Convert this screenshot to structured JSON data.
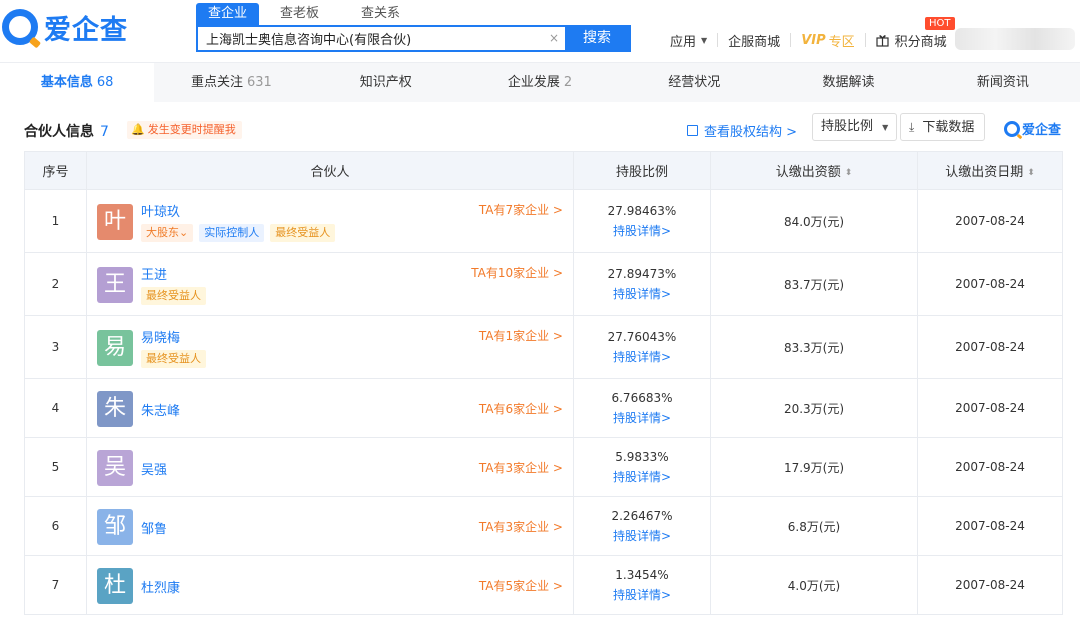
{
  "header": {
    "logo_text": "爱企查",
    "search_tabs": [
      "查企业",
      "查老板",
      "查关系"
    ],
    "search_value": "上海凯士奥信息咨询中心(有限合伙)",
    "clear_icon": "×",
    "search_button": "搜索",
    "nav": {
      "apps": "应用",
      "service_mall": "企服商城",
      "vip": "VIP",
      "vip_zone": "专区",
      "points_mall": "积分商城",
      "hot": "HOT"
    }
  },
  "section_tabs": [
    {
      "label": "基本信息",
      "count": "68"
    },
    {
      "label": "重点关注",
      "count": "631"
    },
    {
      "label": "知识产权",
      "count": ""
    },
    {
      "label": "企业发展",
      "count": "2"
    },
    {
      "label": "经营状况",
      "count": ""
    },
    {
      "label": "数据解读",
      "count": ""
    },
    {
      "label": "新闻资讯",
      "count": ""
    }
  ],
  "partners": {
    "title": "合伙人信息",
    "count": "7",
    "alert": "发生变更时提醒我",
    "equity_link": "查看股权结构 >",
    "ratio_button": "持股比例",
    "download_button": "下载数据",
    "brand": "爱企查",
    "columns": {
      "seq": "序号",
      "partner": "合伙人",
      "ratio": "持股比例",
      "capital": "认缴出资额",
      "date": "认缴出资日期"
    },
    "detail_label": "持股详情>",
    "rows": [
      {
        "seq": "1",
        "avatar": "叶",
        "avatar_color": "#e58a6d",
        "name": "叶琼玖",
        "tags": [
          {
            "text": "大股东⌄",
            "style": "orange"
          },
          {
            "text": "实际控制人",
            "style": "blue"
          },
          {
            "text": "最终受益人",
            "style": "yellow"
          }
        ],
        "companies": "TA有7家企业 >",
        "ratio": "27.98463%",
        "capital": "84.0万(元)",
        "date": "2007-08-24"
      },
      {
        "seq": "2",
        "avatar": "王",
        "avatar_color": "#b49fd3",
        "name": "王进",
        "tags": [
          {
            "text": "最终受益人",
            "style": "yellow"
          }
        ],
        "companies": "TA有10家企业 >",
        "ratio": "27.89473%",
        "capital": "83.7万(元)",
        "date": "2007-08-24"
      },
      {
        "seq": "3",
        "avatar": "易",
        "avatar_color": "#78c39c",
        "name": "易晓梅",
        "tags": [
          {
            "text": "最终受益人",
            "style": "yellow"
          }
        ],
        "companies": "TA有1家企业 >",
        "ratio": "27.76043%",
        "capital": "83.3万(元)",
        "date": "2007-08-24"
      },
      {
        "seq": "4",
        "avatar": "朱",
        "avatar_color": "#7f97c7",
        "name": "朱志峰",
        "tags": [],
        "companies": "TA有6家企业 >",
        "ratio": "6.76683%",
        "capital": "20.3万(元)",
        "date": "2007-08-24"
      },
      {
        "seq": "5",
        "avatar": "吴",
        "avatar_color": "#b9a5d6",
        "name": "吴强",
        "tags": [],
        "companies": "TA有3家企业 >",
        "ratio": "5.9833%",
        "capital": "17.9万(元)",
        "date": "2007-08-24"
      },
      {
        "seq": "6",
        "avatar": "邹",
        "avatar_color": "#8ab3e8",
        "name": "邹鲁",
        "tags": [],
        "companies": "TA有3家企业 >",
        "ratio": "2.26467%",
        "capital": "6.8万(元)",
        "date": "2007-08-24"
      },
      {
        "seq": "7",
        "avatar": "杜",
        "avatar_color": "#5aa3c4",
        "name": "杜烈康",
        "tags": [],
        "companies": "TA有5家企业 >",
        "ratio": "1.3454%",
        "capital": "4.0万(元)",
        "date": "2007-08-24"
      }
    ]
  }
}
